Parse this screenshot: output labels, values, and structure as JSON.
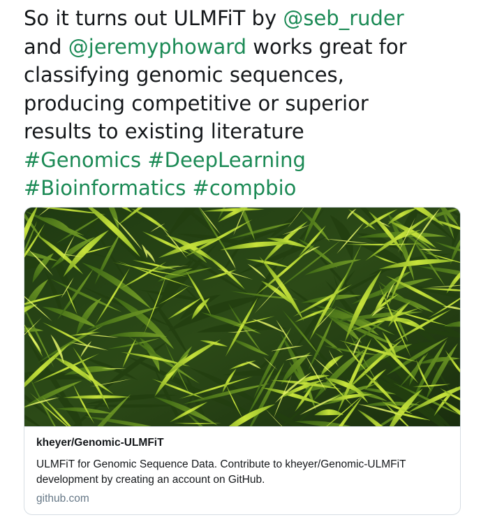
{
  "tweet": {
    "text_segments": [
      "So it turns out ULMFiT by ",
      "@seb_ruder",
      "\nand ",
      "@jeremyphoward",
      " works great for\nclassifying genomic sequences,\nproducing competitive or superior\nresults to existing literature\n",
      "#Genomics",
      " ",
      "#DeepLearning",
      "\n",
      "#Bioinformatics",
      " ",
      "#compbio"
    ]
  },
  "card": {
    "image_icon": "palm-leaves-photo",
    "title": "kheyer/Genomic-ULMFiT",
    "description": "ULMFiT for Genomic Sequence Data. Contribute to kheyer/Genomic-ULMFiT development by creating an account on GitHub.",
    "domain": "github.com"
  },
  "colors": {
    "link": "#1b8a55",
    "text": "#14171a",
    "muted": "#657786",
    "border": "#d6dde3"
  }
}
